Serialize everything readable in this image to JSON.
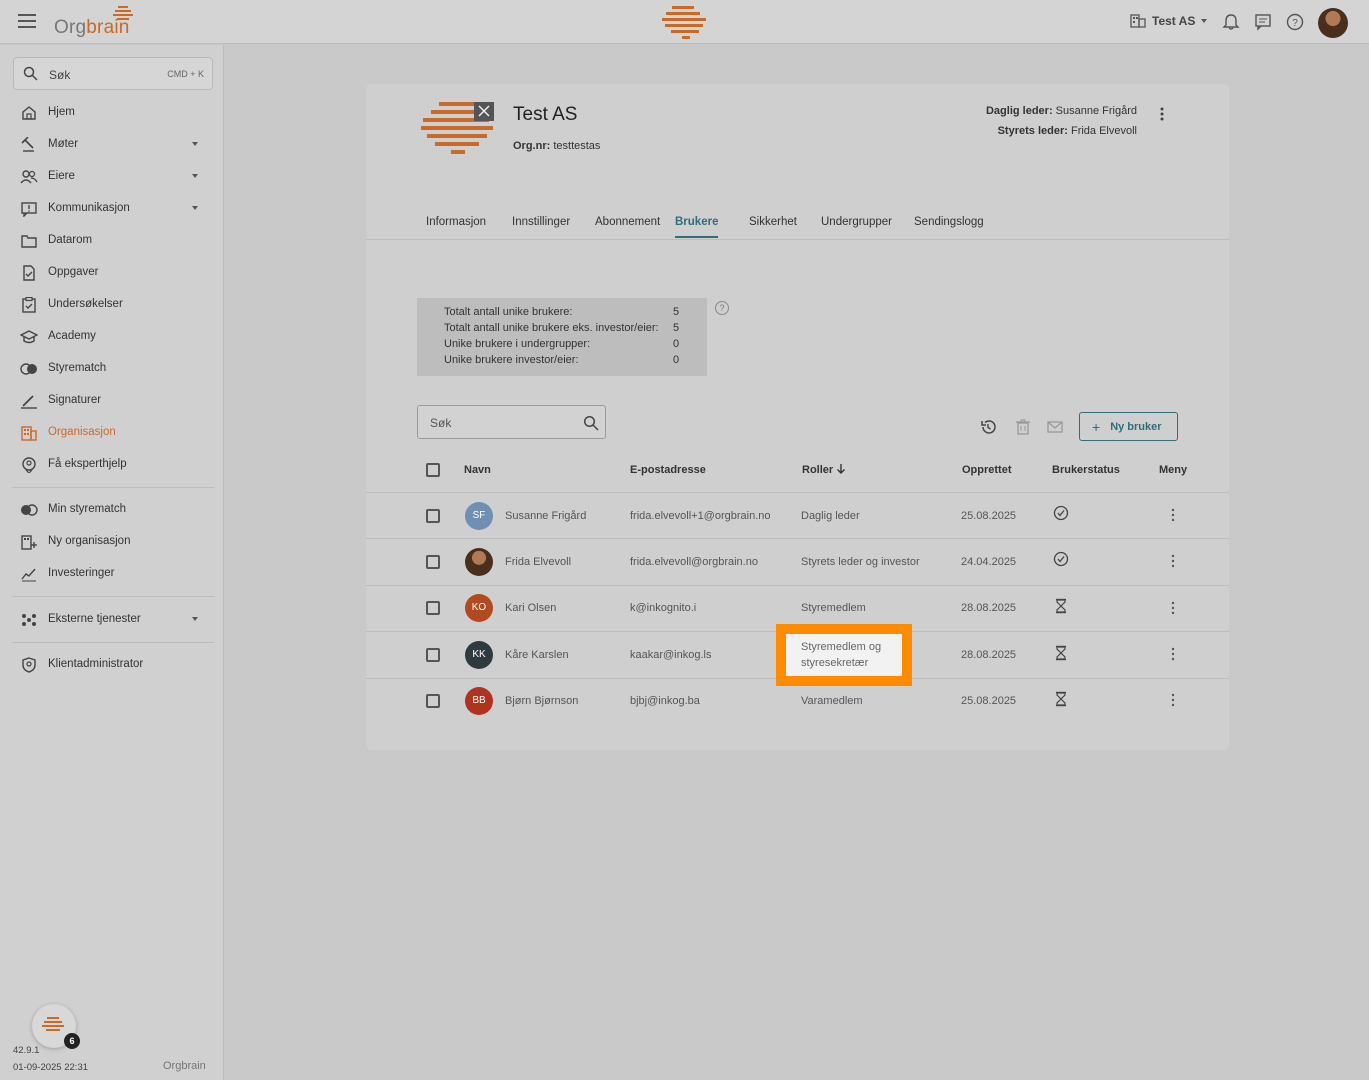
{
  "app": {
    "brand_prefix": "Org",
    "brand_suffix": "brain",
    "org_selector_label": "Test AS"
  },
  "sidebar": {
    "search_label": "Søk",
    "search_shortcut": "CMD + K",
    "items": [
      {
        "label": "Hjem",
        "icon": "home-icon"
      },
      {
        "label": "Møter",
        "icon": "gavel-icon",
        "has_caret": true
      },
      {
        "label": "Eiere",
        "icon": "people-icon",
        "has_caret": true
      },
      {
        "label": "Kommunikasjon",
        "icon": "message-alert-icon",
        "has_caret": true
      },
      {
        "label": "Datarom",
        "icon": "folder-icon"
      },
      {
        "label": "Oppgaver",
        "icon": "task-icon"
      },
      {
        "label": "Undersøkelser",
        "icon": "survey-icon"
      },
      {
        "label": "Academy",
        "icon": "graduation-cap-icon"
      },
      {
        "label": "Styrematch",
        "icon": "match-icon"
      },
      {
        "label": "Signaturer",
        "icon": "pen-icon"
      },
      {
        "label": "Organisasjon",
        "icon": "building-icon",
        "active": true
      },
      {
        "label": "Få eksperthjelp",
        "icon": "expert-help-icon"
      }
    ],
    "secondary_items": [
      {
        "label": "Min styrematch",
        "icon": "toggle-icon"
      },
      {
        "label": "Ny organisasjon",
        "icon": "add-building-icon"
      },
      {
        "label": "Investeringer",
        "icon": "chart-icon"
      }
    ],
    "external_label": "Eksterne tjenester",
    "admin_label": "Klientadministrator",
    "version": "42.9.1",
    "timestamp": "01-09-2025 22:31",
    "help_badge_count": "6",
    "footer_brand": "Orgbrain"
  },
  "org": {
    "name": "Test AS",
    "orgnr_label": "Org.nr:",
    "orgnr_value": "testtestas",
    "ceo_label": "Daglig leder:",
    "ceo_name": "Susanne Frigård",
    "chair_label": "Styrets leder:",
    "chair_name": "Frida Elvevoll"
  },
  "tabs": [
    "Informasjon",
    "Innstillinger",
    "Abonnement",
    "Brukere",
    "Sikkerhet",
    "Undergrupper",
    "Sendingslogg"
  ],
  "active_tab": "Brukere",
  "stats": [
    {
      "label": "Totalt antall unike brukere:",
      "value": "5"
    },
    {
      "label": "Totalt antall unike brukere eks. investor/eier:",
      "value": "5"
    },
    {
      "label": "Unike brukere i undergrupper:",
      "value": "0"
    },
    {
      "label": "Unike brukere investor/eier:",
      "value": "0"
    }
  ],
  "stats_help": "?",
  "user_search_placeholder": "Søk",
  "new_user_label": "Ny bruker",
  "table": {
    "headers": {
      "name": "Navn",
      "email": "E-postadresse",
      "roles": "Roller",
      "created": "Opprettet",
      "status": "Brukerstatus",
      "menu": "Meny"
    },
    "rows": [
      {
        "initials": "SF",
        "avatar_color": "#6f8fb3",
        "name": "Susanne Frigård",
        "email": "frida.elvevoll+1@orgbrain.no",
        "role": "Daglig leder",
        "created": "25.08.2025",
        "status": "active"
      },
      {
        "initials": "",
        "avatar_color": "#4a2e1e",
        "name": "Frida Elvevoll",
        "email": "frida.elvevoll@orgbrain.no",
        "role": "Styrets leder og investor",
        "created": "24.04.2025",
        "status": "active"
      },
      {
        "initials": "KO",
        "avatar_color": "#b34a1f",
        "name": "Kari Olsen",
        "email": "k@inkognito.i",
        "role": "Styremedlem",
        "created": "28.08.2025",
        "status": "pending"
      },
      {
        "initials": "KK",
        "avatar_color": "#2f3a40",
        "name": "Kåre Karslen",
        "email": "kaakar@inkog.ls",
        "role": "",
        "created": "28.08.2025",
        "status": "pending"
      },
      {
        "initials": "BB",
        "avatar_color": "#b0331f",
        "name": "Bjørn Bjørnson",
        "email": "bjbj@inkog.ba",
        "role": "Varamedlem",
        "created": "25.08.2025",
        "status": "pending"
      }
    ]
  },
  "highlight": {
    "line1": "Styremedlem og",
    "line2": "styresekretær",
    "color": "#ff8c00"
  },
  "colors": {
    "accent": "#2f6f78",
    "brand": "#c86a2a"
  }
}
